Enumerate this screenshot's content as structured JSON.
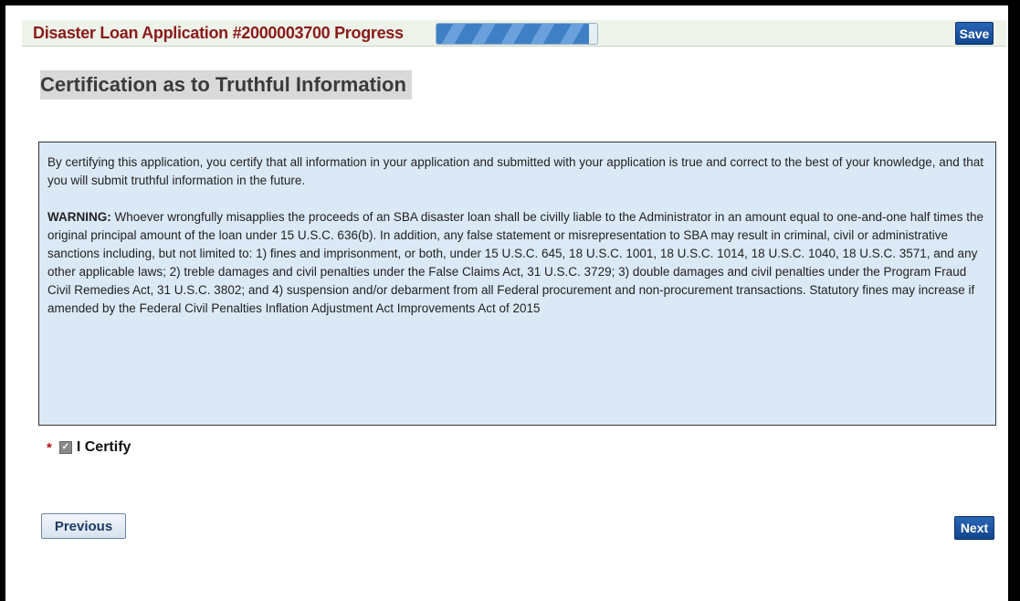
{
  "header": {
    "title": "Disaster Loan Application #2000003700  Progress",
    "progress_fraction": 0.95,
    "save_label": "Save"
  },
  "section": {
    "title": "Certification as to Truthful Information"
  },
  "certification": {
    "intro": "By certifying this application, you certify that all information in your application and submitted with your application is true and correct to the best of your knowledge, and that you will submit truthful information in the future.",
    "warning_label": "WARNING:",
    "warning_text": " Whoever wrongfully misapplies the proceeds of an SBA disaster loan shall be civilly liable to the Administrator in an amount equal to one-and-one half times the original principal amount of the loan under 15 U.S.C. 636(b). In addition, any false statement or misrepresentation to SBA may result in criminal, civil or administrative sanctions including, but not limited to: 1) fines and imprisonment, or both, under 15 U.S.C. 645, 18 U.S.C. 1001, 18 U.S.C. 1014, 18 U.S.C. 1040, 18 U.S.C. 3571, and any other applicable laws; 2) treble damages and civil penalties under the False Claims Act, 31 U.S.C. 3729; 3) double damages and civil penalties under the Program Fraud Civil Remedies Act, 31 U.S.C. 3802; and 4) suspension and/or debarment from all Federal procurement and non-procurement transactions. Statutory fines may increase if amended by the Federal Civil Penalties Inflation Adjustment Act Improvements Act of 2015"
  },
  "certify_checkbox": {
    "required_marker": "*",
    "checked": true,
    "label": "I Certify"
  },
  "nav": {
    "previous_label": "Previous",
    "next_label": "Next"
  }
}
